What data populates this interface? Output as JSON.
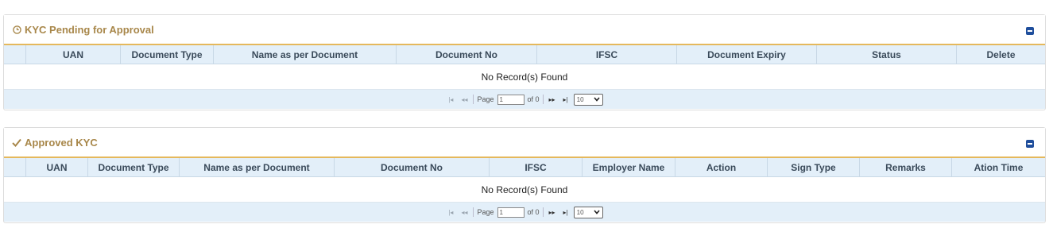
{
  "pending": {
    "title": "KYC Pending for Approval",
    "icon": "clock-icon",
    "columns": [
      "",
      "UAN",
      "Document Type",
      "Name as per Document",
      "Document No",
      "IFSC",
      "Document Expiry",
      "Status",
      "Delete"
    ],
    "empty_message": "No Record(s) Found",
    "pager": {
      "page_label": "Page",
      "page_value": "1",
      "of_label": "of 0",
      "page_size": "10"
    }
  },
  "approved": {
    "title": "Approved KYC",
    "icon": "check-icon",
    "columns": [
      "",
      "UAN",
      "Document Type",
      "Name as per Document",
      "Document No",
      "IFSC",
      "Employer Name",
      "Action",
      "Sign Type",
      "Remarks",
      "Ation Time"
    ],
    "empty_message": "No Record(s) Found",
    "pager": {
      "page_label": "Page",
      "page_value": "1",
      "of_label": "of 0",
      "page_size": "10"
    }
  },
  "colors": {
    "title": "#a8874a",
    "accent_line": "#e5b85c",
    "header_bg": "#e3eff9",
    "collapse_btn": "#1f4e9c"
  }
}
